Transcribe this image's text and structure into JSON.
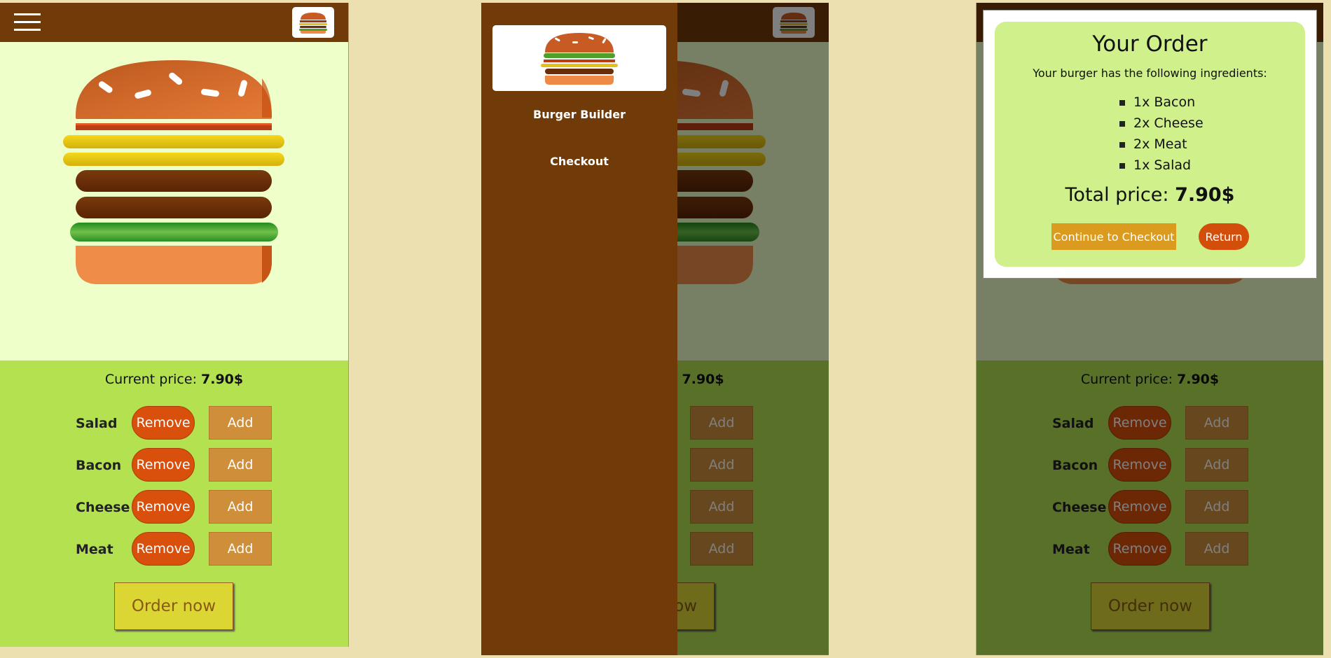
{
  "colors": {
    "page_background": "#ede0b0",
    "toolbar": "#703b09",
    "burger_area": "#efffc9",
    "controls_area": "#b3e150",
    "remove_button": "#d8500b",
    "add_button": "#cf8e3a",
    "order_button": "#dcd635",
    "modal_panel": "#cff08a",
    "continue_button": "#da9b1e",
    "return_button": "#d34e0b"
  },
  "icons": {
    "menu": "hamburger-menu-icon",
    "logo": "burger-logo-icon"
  },
  "burger": {
    "layers": [
      "bread-top",
      "bacon",
      "cheese",
      "cheese",
      "meat",
      "meat",
      "salad",
      "bread-bottom"
    ]
  },
  "controls": {
    "price_label": "Current price:",
    "price_value": "7.90$",
    "rows": [
      {
        "label": "Salad",
        "remove": "Remove",
        "add": "Add"
      },
      {
        "label": "Bacon",
        "remove": "Remove",
        "add": "Add"
      },
      {
        "label": "Cheese",
        "remove": "Remove",
        "add": "Add"
      },
      {
        "label": "Meat",
        "remove": "Remove",
        "add": "Add"
      }
    ],
    "order_label": "Order now"
  },
  "drawer": {
    "nav": [
      "Burger Builder",
      "Checkout"
    ]
  },
  "modal": {
    "title": "Your Order",
    "description": "Your burger has the following ingredients:",
    "items": [
      "1x Bacon",
      "2x Cheese",
      "2x Meat",
      "1x Salad"
    ],
    "total_label": "Total price:",
    "total_value": "7.90$",
    "continue_label": "Continue to Checkout",
    "return_label": "Return"
  }
}
